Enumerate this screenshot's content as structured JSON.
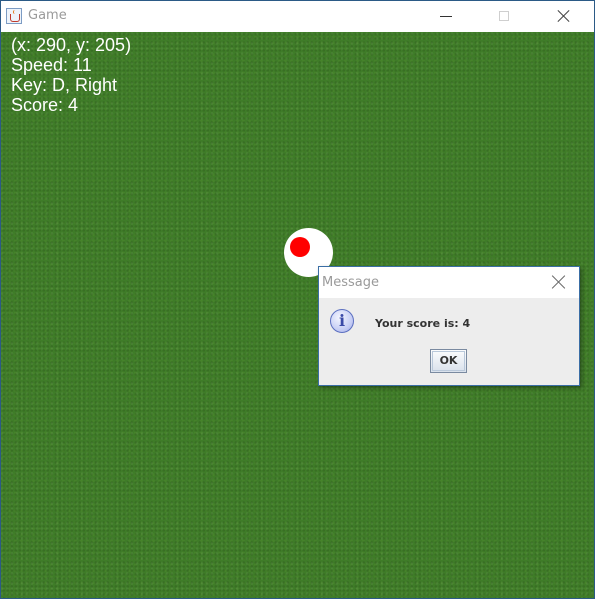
{
  "window": {
    "title": "Game",
    "icon": "java-cup-icon",
    "controls": [
      "minimize",
      "maximize",
      "close"
    ]
  },
  "hud": {
    "position": "(x: 290, y: 205)",
    "speed": "Speed: 11",
    "key": "Key: D, Right",
    "score": "Score: 4"
  },
  "game": {
    "background": "grass-texture",
    "ball_color": "#ffffff",
    "ball_dot_color": "#ff0000"
  },
  "dialog": {
    "title": "Message",
    "icon": "info-icon",
    "icon_glyph": "i",
    "message": "Your score is: 4",
    "ok_label": "OK"
  }
}
